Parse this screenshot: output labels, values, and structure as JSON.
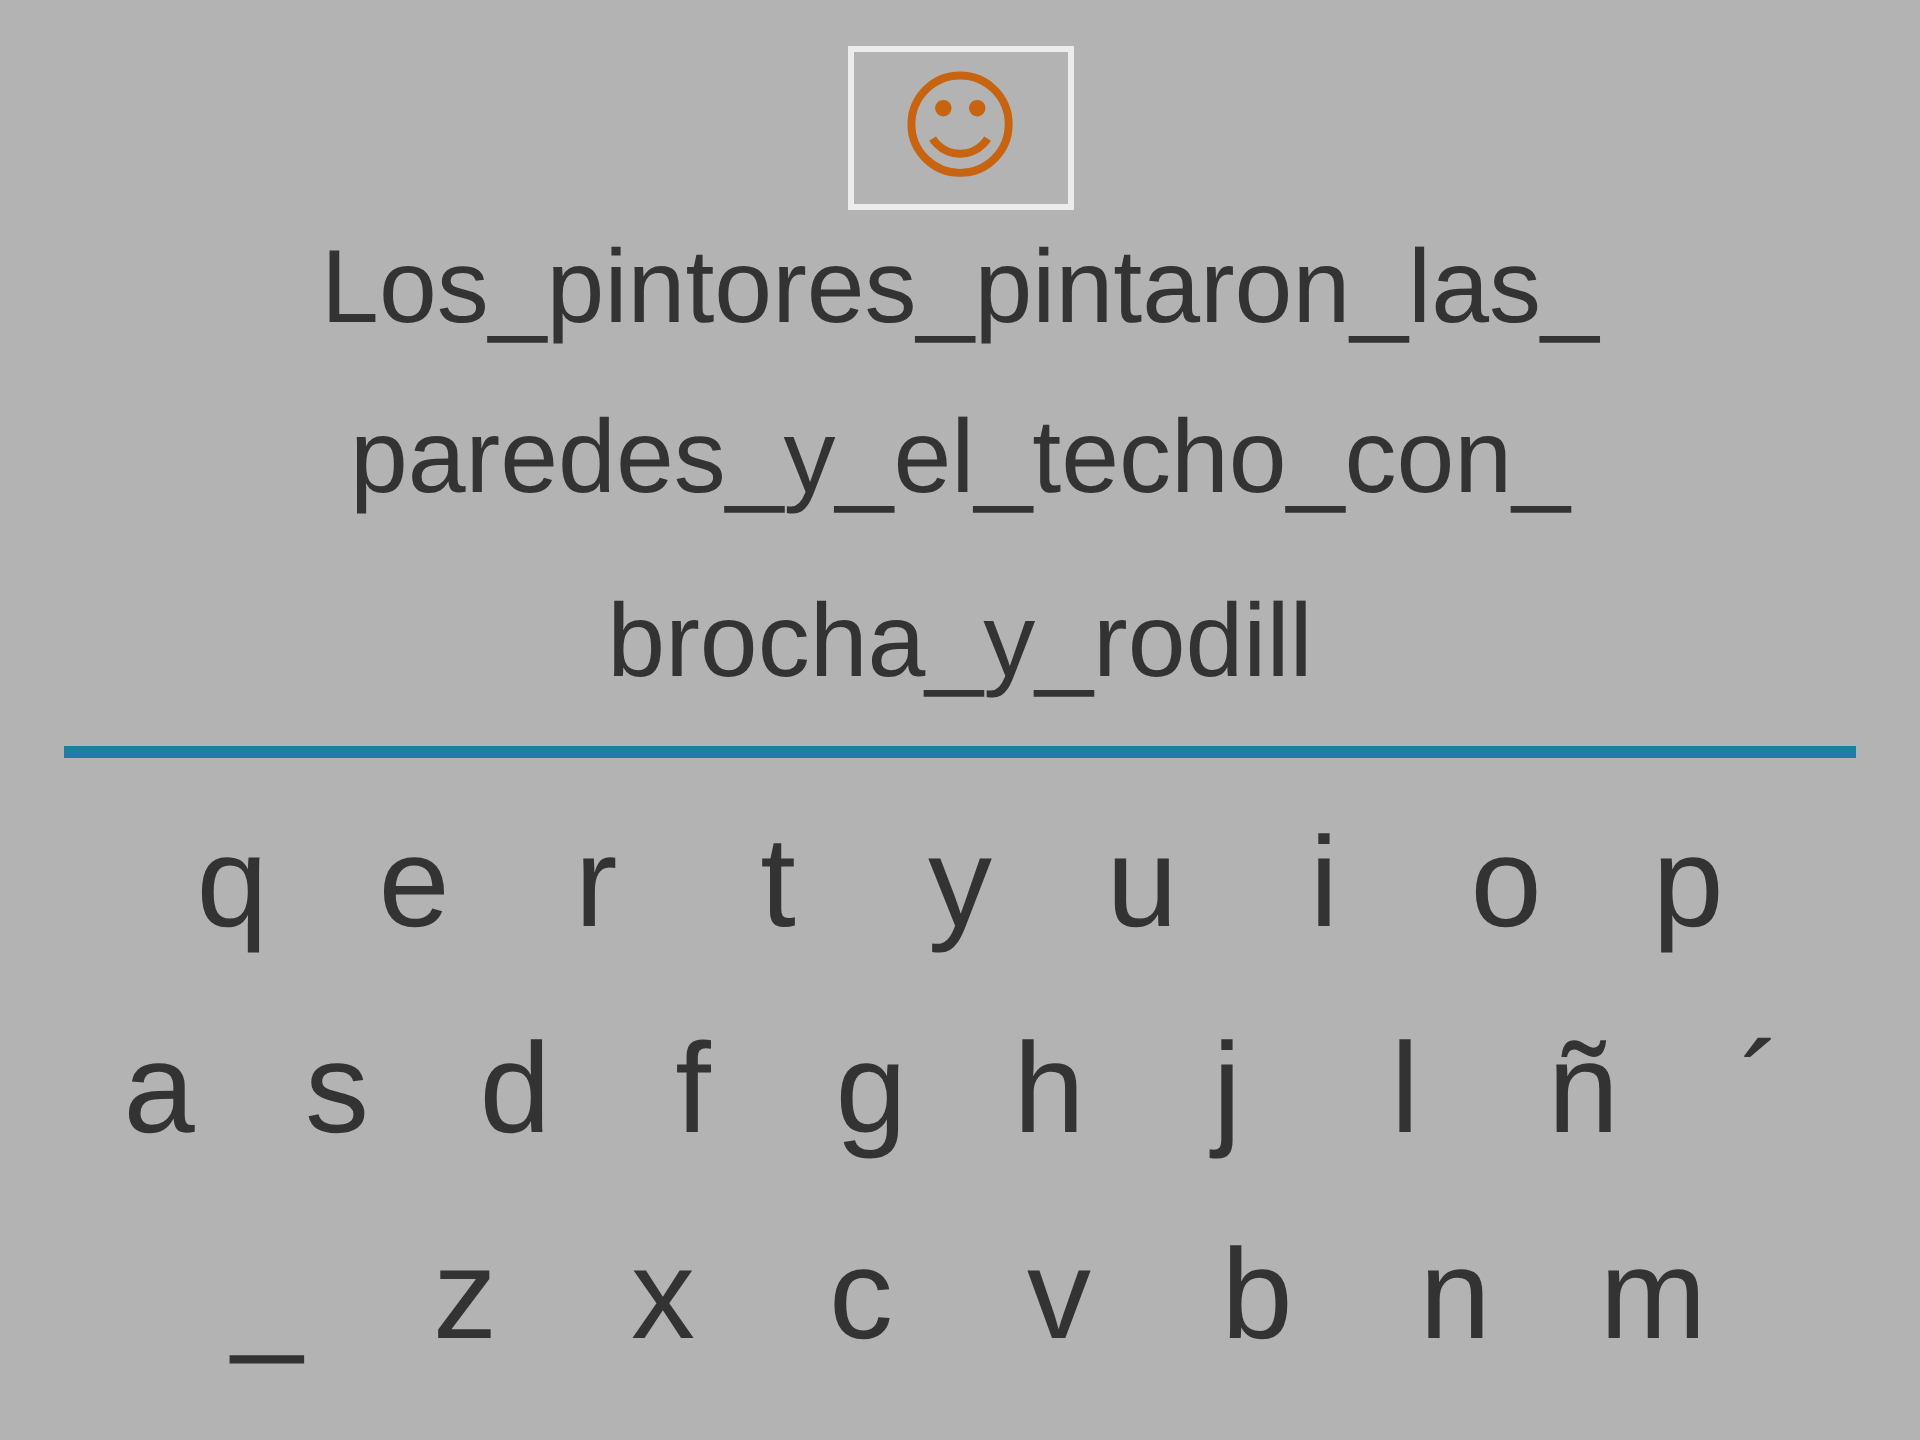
{
  "smiley_button": {
    "symbol": "☺"
  },
  "sentence": [
    "Los_pintores_pintaron_las_",
    "paredes_y_el_techo_con_",
    "brocha_y_rodill"
  ],
  "keyboard": [
    [
      "q",
      "e",
      "r",
      "t",
      "y",
      "u",
      "i",
      "o",
      "p"
    ],
    [
      "a",
      "s",
      "d",
      "f",
      "g",
      "h",
      "j",
      "l",
      "ñ",
      "´"
    ],
    [
      "_",
      "z",
      "x",
      "c",
      "v",
      "b",
      "n",
      "m"
    ]
  ]
}
